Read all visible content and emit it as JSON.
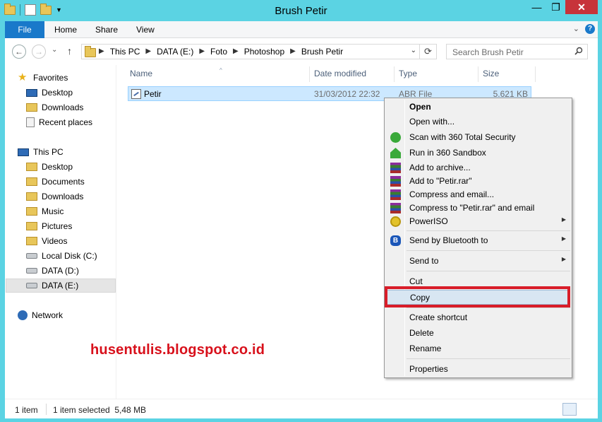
{
  "window": {
    "title": "Brush Petir",
    "minimize_glyph": "—",
    "maximize_glyph": "❐",
    "close_glyph": "✕"
  },
  "ribbon": {
    "tabs": [
      "File",
      "Home",
      "Share",
      "View"
    ],
    "expand_glyph": "⌄",
    "help_glyph": "?"
  },
  "navigation": {
    "back_glyph": "←",
    "forward_glyph": "→",
    "recent_glyph": "⌄",
    "up_glyph": "↑",
    "breadcrumbs": [
      "This PC",
      "DATA (E:)",
      "Foto",
      "Photoshop",
      "Brush Petir"
    ],
    "crumb_separator": "▶",
    "dropdown_glyph": "⌄",
    "refresh_glyph": "⟳",
    "search_placeholder": "Search Brush Petir"
  },
  "nav_pane": {
    "favorites": {
      "label": "Favorites",
      "items": [
        "Desktop",
        "Downloads",
        "Recent places"
      ]
    },
    "this_pc": {
      "label": "This PC",
      "items": [
        "Desktop",
        "Documents",
        "Downloads",
        "Music",
        "Pictures",
        "Videos",
        "Local Disk (C:)",
        "DATA (D:)",
        "DATA (E:)"
      ]
    },
    "network": {
      "label": "Network"
    }
  },
  "file_list": {
    "columns": [
      "Name",
      "Date modified",
      "Type",
      "Size"
    ],
    "sort_glyph": "^",
    "files": [
      {
        "name": "Petir",
        "date_modified": "31/03/2012 22:32",
        "type": "ABR File",
        "size": "5.621 KB"
      }
    ]
  },
  "context_menu": {
    "items": [
      {
        "label": "Open",
        "icon": "none"
      },
      {
        "label": "Open with...",
        "icon": "none"
      },
      {
        "label": "Scan with 360 Total Security",
        "icon": "360-icon"
      },
      {
        "label": "Run in 360 Sandbox",
        "icon": "sandbox-icon"
      },
      {
        "label": "Add to archive...",
        "icon": "winrar-icon"
      },
      {
        "label": "Add to \"Petir.rar\"",
        "icon": "winrar-icon"
      },
      {
        "label": "Compress and email...",
        "icon": "winrar-icon"
      },
      {
        "label": "Compress to \"Petir.rar\" and email",
        "icon": "winrar-icon"
      },
      {
        "label": "PowerISO",
        "icon": "poweriso-icon"
      },
      {
        "label": "Send by Bluetooth to",
        "icon": "bluetooth-icon"
      },
      {
        "label": "Send to",
        "icon": "none"
      },
      {
        "label": "Cut",
        "icon": "none"
      },
      {
        "label": "Copy",
        "icon": "none"
      },
      {
        "label": "Create shortcut",
        "icon": "none"
      },
      {
        "label": "Delete",
        "icon": "none"
      },
      {
        "label": "Rename",
        "icon": "none"
      },
      {
        "label": "Properties",
        "icon": "none"
      }
    ],
    "submenu_glyph": "▶",
    "bluetooth_glyph": "B",
    "highlight_color": "#d81d29"
  },
  "watermark": "husentulis.blogspot.co.id",
  "status_bar": {
    "item_count": "1 item",
    "selection": "1 item selected  5,48 MB"
  },
  "colors": {
    "title_bar": "#5bd3e3",
    "file_tab": "#1979ca",
    "selection": "#cce8ff",
    "watermark": "#d81d29"
  }
}
